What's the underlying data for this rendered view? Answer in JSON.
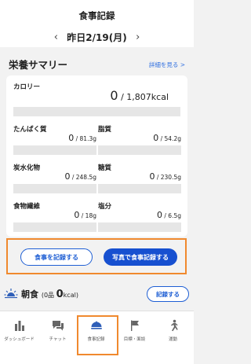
{
  "header": {
    "title": "食事記録",
    "prev_arrow": "‹",
    "next_arrow": "›",
    "date": "昨日2/19(月)"
  },
  "summary": {
    "title": "栄養サマリー",
    "detail_link": "詳細を見る >",
    "calorie": {
      "label": "カロリー",
      "current": "0",
      "target": " / 1,807kcal"
    },
    "nutrients": [
      {
        "label": "たんぱく質",
        "current": "0",
        "target": " / 81.3g"
      },
      {
        "label": "脂質",
        "current": "0",
        "target": " / 54.2g"
      },
      {
        "label": "炭水化物",
        "current": "0",
        "target": " / 248.5g"
      },
      {
        "label": "糖質",
        "current": "0",
        "target": " / 230.5g"
      },
      {
        "label": "食物繊維",
        "current": "0",
        "target": " / 18g"
      },
      {
        "label": "塩分",
        "current": "0",
        "target": " / 6.5g"
      }
    ]
  },
  "actions": {
    "record_meal": "食事を記録する",
    "record_with_photo": "写真で食事記録する"
  },
  "meal": {
    "name": "朝食",
    "count_prefix": "(0品 ",
    "kcal_value": "0",
    "kcal_suffix": "kcal)",
    "record_button": "記録する"
  },
  "tabs": [
    {
      "label": "ダッシュボード",
      "icon": "bar-chart-icon"
    },
    {
      "label": "チャット",
      "icon": "chat-icon"
    },
    {
      "label": "食事記録",
      "icon": "meal-icon",
      "active": true
    },
    {
      "label": "目標・面談",
      "icon": "flag-icon"
    },
    {
      "label": "運動",
      "icon": "running-icon"
    }
  ],
  "colors": {
    "accent_blue": "#1750d0",
    "link_blue": "#2f6fe0",
    "highlight_orange": "#f0892e"
  }
}
